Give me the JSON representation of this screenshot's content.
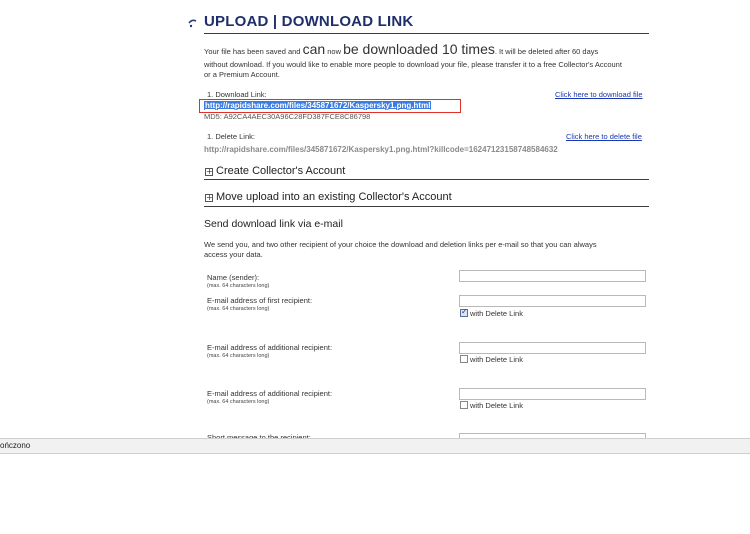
{
  "header": {
    "title": "UPLOAD | DOWNLOAD LINK"
  },
  "intro": {
    "part1": "Your file has been saved and",
    "big_can": "can",
    "part2": "now",
    "big_downloaded": "be downloaded 10 times",
    "part3": ". It will be deleted after 60 days",
    "line2": "without download. If you would like to enable more people to download your file, please transfer it to a free Collector's Account",
    "line3": "or a Premium Account."
  },
  "download": {
    "label": "1. Download Link:",
    "url": "http://rapidshare.com/files/345871672/Kaspersky1.png.html",
    "md5": "MD5: A92CA4AEC30A96C28FD387FCE8C86798",
    "click_link": "Click here to download file"
  },
  "delete": {
    "label": "1. Delete Link:",
    "url": "http://rapidshare.com/files/345871672/Kaspersky1.png.html?killcode=16247123158748584632",
    "click_link": "Click here to delete file"
  },
  "sections": {
    "create_account": "Create Collector's Account",
    "move_upload": "Move upload into an existing Collector's Account"
  },
  "email_form": {
    "heading": "Send download link via e-mail",
    "desc_line1": "We send you, and two other recipient of your choice the download and deletion links per e-mail so that you can always",
    "desc_line2": "access your data.",
    "name_label": "Name (sender):",
    "max_chars": "(max. 64 characters long)",
    "email1_label": "E-mail address of first recipient:",
    "email2_label": "E-mail address of additional recipient:",
    "email3_label": "E-mail address of additional recipient:",
    "with_delete_link": "with Delete Link",
    "short_message_label": "Short message to the recipient:"
  },
  "statusbar": {
    "text": "ończono"
  }
}
